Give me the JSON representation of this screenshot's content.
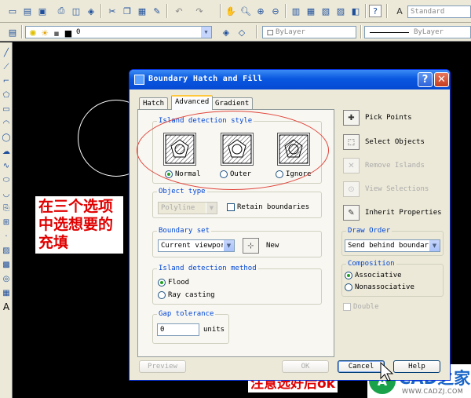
{
  "toolbar": {
    "text_style": "Standard",
    "layer": "0",
    "color": "ByLayer",
    "linetype": "ByLayer"
  },
  "canvas": {
    "note_left": "在三个选项中选想要的充填",
    "note_bottom": "注意选好后ok",
    "logo_text": "CAD之家",
    "logo_url": "WWW.CADZJ.COM",
    "logo_mark": "A"
  },
  "dialog": {
    "title": "Boundary Hatch and Fill",
    "help_glyph": "?",
    "close_glyph": "✕",
    "tabs": [
      "Hatch",
      "Advanced",
      "Gradient"
    ],
    "active_tab": "Advanced",
    "island_style": {
      "label": "Island detection style",
      "options": [
        "Normal",
        "Outer",
        "Ignore"
      ],
      "selected": "Normal"
    },
    "object_type": {
      "label": "Object type",
      "value": "Polyline",
      "retain_label": "Retain boundaries"
    },
    "boundary_set": {
      "label": "Boundary set",
      "value": "Current viewport",
      "new_label": "New"
    },
    "island_method": {
      "label": "Island detection method",
      "options": [
        "Flood",
        "Ray casting"
      ],
      "selected": "Flood"
    },
    "gap": {
      "label": "Gap tolerance",
      "value": "0",
      "units": "units"
    },
    "right": {
      "pick_points": "Pick Points",
      "select_objects": "Select Objects",
      "remove_islands": "Remove Islands",
      "view_selections": "View Selections",
      "inherit_properties": "Inherit Properties",
      "draw_order_label": "Draw Order",
      "draw_order_value": "Send behind boundary",
      "composition_label": "Composition",
      "composition_options": [
        "Associative",
        "Nonassociative"
      ],
      "composition_selected": "Associative",
      "double_label": "Double"
    },
    "buttons": {
      "preview": "Preview",
      "ok": "OK",
      "cancel": "Cancel",
      "help": "Help"
    }
  }
}
